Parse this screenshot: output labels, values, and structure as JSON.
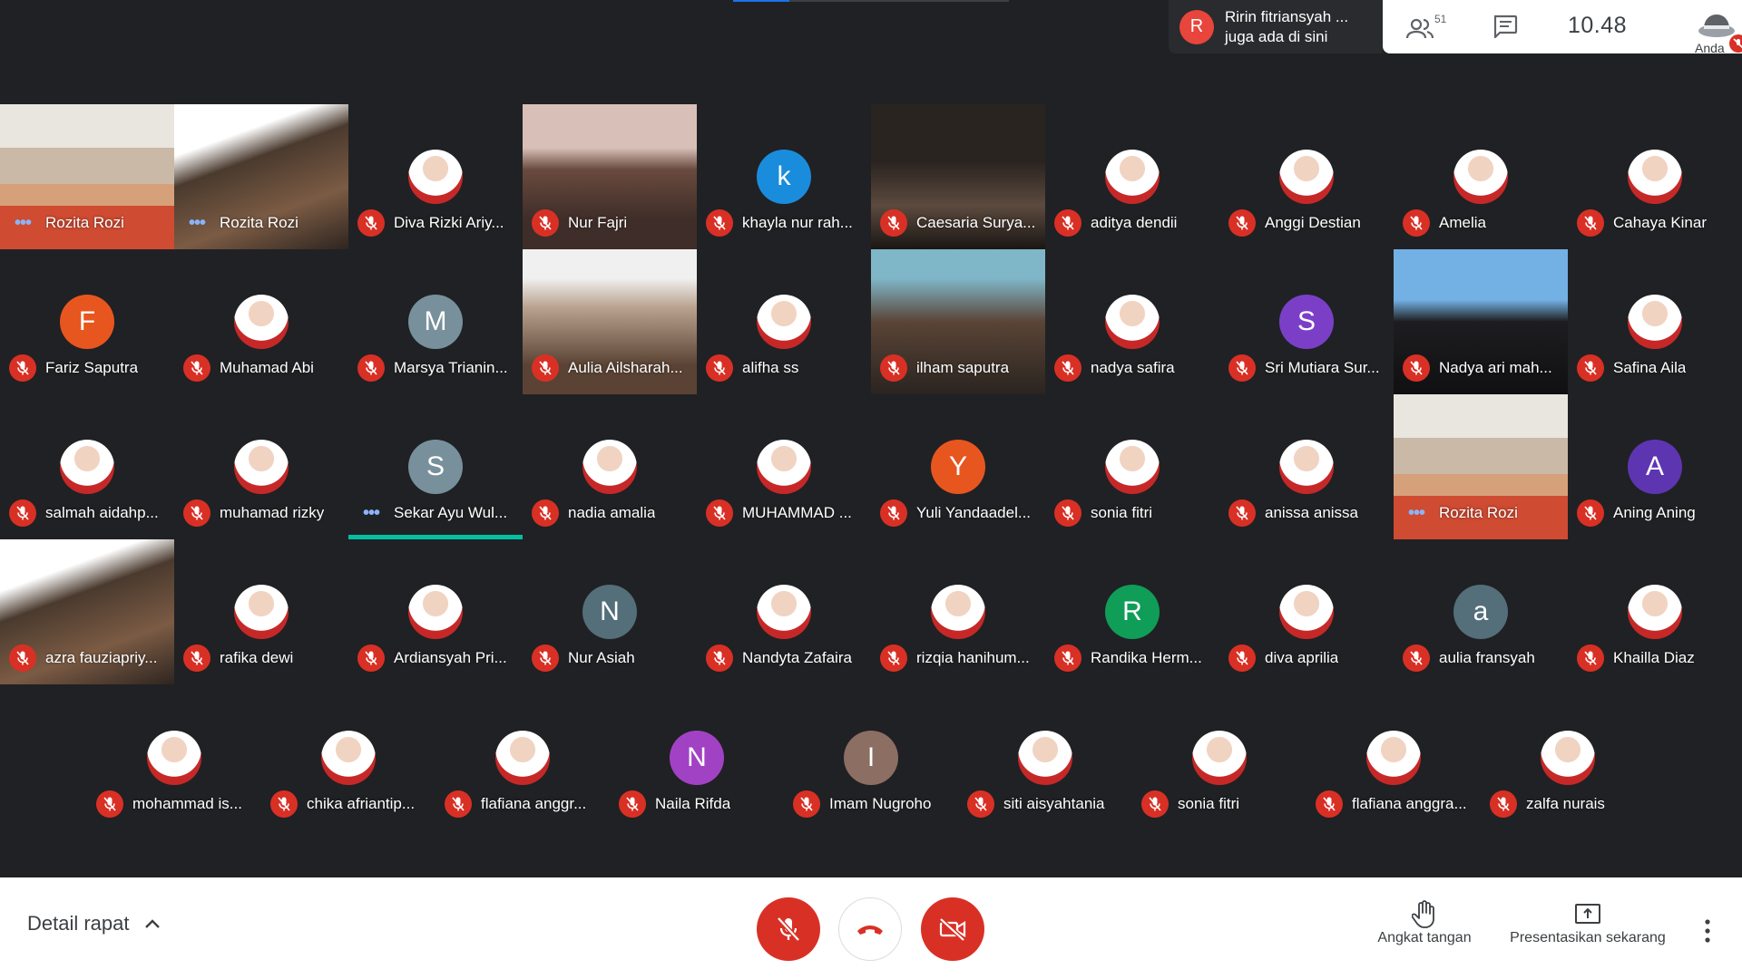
{
  "notification": {
    "initial": "R",
    "line1": "Ririn fitriansyah ...",
    "line2": "juga ada di sini",
    "color": "#e8453c"
  },
  "topbar": {
    "participant_count": "51",
    "time": "10.48",
    "you_label": "Anda"
  },
  "rows": [
    [
      {
        "name": "Rozita Rozi",
        "kind": "video",
        "status": "dots"
      },
      {
        "name": "Rozita Rozi",
        "kind": "video",
        "status": "dots"
      },
      {
        "name": "Diva Rizki Ariy...",
        "kind": "photo",
        "status": "muted"
      },
      {
        "name": "Nur Fajri",
        "kind": "video",
        "status": "muted"
      },
      {
        "name": "khayla nur rah...",
        "kind": "letter",
        "initial": "k",
        "color": "#1a8cdc",
        "status": "muted"
      },
      {
        "name": "Caesaria Surya...",
        "kind": "video",
        "status": "muted"
      },
      {
        "name": "aditya dendii",
        "kind": "photo",
        "status": "muted"
      },
      {
        "name": "Anggi Destian",
        "kind": "photo",
        "status": "muted"
      },
      {
        "name": "Amelia",
        "kind": "photo",
        "status": "muted"
      },
      {
        "name": "Cahaya Kinar",
        "kind": "photo",
        "status": "muted"
      }
    ],
    [
      {
        "name": "Fariz Saputra",
        "kind": "letter",
        "initial": "F",
        "color": "#e8561f",
        "status": "muted"
      },
      {
        "name": "Muhamad Abi",
        "kind": "photo",
        "status": "muted"
      },
      {
        "name": "Marsya Trianin...",
        "kind": "letter",
        "initial": "M",
        "color": "#78909c",
        "status": "muted"
      },
      {
        "name": "Aulia Ailsharah...",
        "kind": "video",
        "status": "muted"
      },
      {
        "name": "alifha ss",
        "kind": "photo",
        "status": "muted"
      },
      {
        "name": "ilham saputra",
        "kind": "video",
        "status": "muted"
      },
      {
        "name": "nadya safira",
        "kind": "photo",
        "status": "muted"
      },
      {
        "name": "Sri Mutiara Sur...",
        "kind": "letter",
        "initial": "S",
        "color": "#7b3fc7",
        "status": "muted"
      },
      {
        "name": "Nadya ari mah...",
        "kind": "video",
        "status": "muted"
      },
      {
        "name": "Safina Aila",
        "kind": "photo",
        "status": "muted"
      }
    ],
    [
      {
        "name": "salmah aidahp...",
        "kind": "photo",
        "status": "muted"
      },
      {
        "name": "muhamad rizky",
        "kind": "photo",
        "status": "muted"
      },
      {
        "name": "Sekar Ayu Wul...",
        "kind": "letter",
        "initial": "S",
        "color": "#78909c",
        "status": "dots",
        "active": true
      },
      {
        "name": "nadia amalia",
        "kind": "photo",
        "status": "muted"
      },
      {
        "name": "MUHAMMAD ...",
        "kind": "photo",
        "status": "muted"
      },
      {
        "name": "Yuli Yandaadel...",
        "kind": "letter",
        "initial": "Y",
        "color": "#e8561f",
        "status": "muted"
      },
      {
        "name": "sonia fitri",
        "kind": "photo",
        "status": "muted"
      },
      {
        "name": "anissa anissa",
        "kind": "photo",
        "status": "muted"
      },
      {
        "name": "Rozita Rozi",
        "kind": "video",
        "status": "dots"
      },
      {
        "name": "Aning Aning",
        "kind": "letter",
        "initial": "A",
        "color": "#5e35b1",
        "status": "muted"
      }
    ],
    [
      {
        "name": "azra fauziapriy...",
        "kind": "video",
        "status": "muted"
      },
      {
        "name": "rafika dewi",
        "kind": "photo",
        "status": "muted"
      },
      {
        "name": "Ardiansyah Pri...",
        "kind": "photo",
        "status": "muted"
      },
      {
        "name": "Nur Asiah",
        "kind": "letter",
        "initial": "N",
        "color": "#546e7a",
        "status": "muted"
      },
      {
        "name": "Nandyta Zafaira",
        "kind": "photo",
        "status": "muted"
      },
      {
        "name": "rizqia hanihum...",
        "kind": "photo",
        "status": "muted"
      },
      {
        "name": "Randika Herm...",
        "kind": "letter",
        "initial": "R",
        "color": "#0f9d58",
        "status": "muted"
      },
      {
        "name": "diva aprilia",
        "kind": "photo",
        "status": "muted"
      },
      {
        "name": "aulia fransyah",
        "kind": "letter",
        "initial": "a",
        "color": "#546e7a",
        "status": "muted"
      },
      {
        "name": "Khailla Diaz",
        "kind": "photo",
        "status": "muted"
      }
    ],
    [
      {
        "name": "mohammad is...",
        "kind": "photo",
        "status": "muted"
      },
      {
        "name": "chika afriantip...",
        "kind": "photo",
        "status": "muted"
      },
      {
        "name": "flafiana anggr...",
        "kind": "photo",
        "status": "muted"
      },
      {
        "name": "Naila Rifda",
        "kind": "letter",
        "initial": "N",
        "color": "#a142c4",
        "status": "muted"
      },
      {
        "name": "Imam Nugroho",
        "kind": "letter",
        "initial": "I",
        "color": "#8d6e63",
        "status": "muted"
      },
      {
        "name": "siti aisyahtania",
        "kind": "photo",
        "status": "muted"
      },
      {
        "name": "sonia fitri",
        "kind": "photo",
        "status": "muted"
      },
      {
        "name": "flafiana anggra...",
        "kind": "photo",
        "status": "muted"
      },
      {
        "name": "zalfa nurais",
        "kind": "photo",
        "status": "muted"
      }
    ]
  ],
  "bottom": {
    "details_label": "Detail rapat",
    "raise_hand_label": "Angkat tangan",
    "present_label": "Presentasikan sekarang"
  }
}
